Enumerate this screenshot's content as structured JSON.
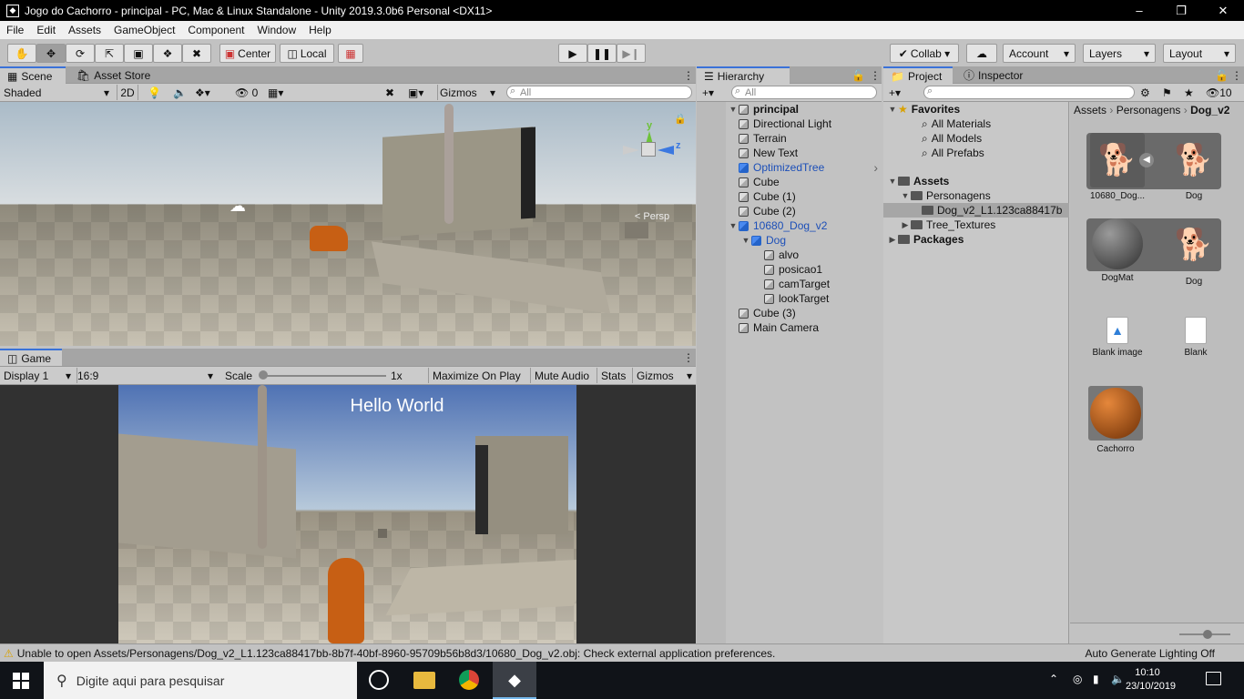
{
  "window": {
    "title": "Jogo do Cachorro - principal - PC, Mac & Linux Standalone - Unity 2019.3.0b6 Personal <DX11>",
    "min": "–",
    "max": "❐",
    "close": "✕"
  },
  "menu": [
    "File",
    "Edit",
    "Assets",
    "GameObject",
    "Component",
    "Window",
    "Help"
  ],
  "toolbar": {
    "center": "Center",
    "local": "Local",
    "collab": "Collab ▾",
    "account": "Account",
    "layers": "Layers",
    "layout": "Layout"
  },
  "scene": {
    "tabs": [
      "Scene",
      "Asset Store"
    ],
    "shading": "Shaded",
    "mode2d": "2D",
    "hidden_count": "0",
    "gizmos": "Gizmos",
    "search_placeholder": "All",
    "persp": "< Persp"
  },
  "game": {
    "tab": "Game",
    "display": "Display 1",
    "aspect": "16:9",
    "scale_label": "Scale",
    "scale_value": "1x",
    "maximize": "Maximize On Play",
    "mute": "Mute Audio",
    "stats": "Stats",
    "gizmos": "Gizmos",
    "hello_text": "Hello World"
  },
  "hierarchy": {
    "tab": "Hierarchy",
    "search_placeholder": "All",
    "items": [
      {
        "label": "principal",
        "depth": 0,
        "caret": "▼",
        "bold": true,
        "icon": "unity-scene-icon"
      },
      {
        "label": "Directional Light",
        "depth": 1
      },
      {
        "label": "Terrain",
        "depth": 1
      },
      {
        "label": "New Text",
        "depth": 1
      },
      {
        "label": "OptimizedTree",
        "depth": 1,
        "blue": true
      },
      {
        "label": "Cube",
        "depth": 1
      },
      {
        "label": "Cube (1)",
        "depth": 1
      },
      {
        "label": "Cube (2)",
        "depth": 1
      },
      {
        "label": "10680_Dog_v2",
        "depth": 1,
        "blue": true,
        "caret": "▼"
      },
      {
        "label": "Dog",
        "depth": 2,
        "blue": true,
        "caret": "▼"
      },
      {
        "label": "alvo",
        "depth": 3
      },
      {
        "label": "posicao1",
        "depth": 3
      },
      {
        "label": "camTarget",
        "depth": 3
      },
      {
        "label": "lookTarget",
        "depth": 3
      },
      {
        "label": "Cube (3)",
        "depth": 1
      },
      {
        "label": "Main Camera",
        "depth": 1
      }
    ]
  },
  "project": {
    "tabs": [
      "Project",
      "Inspector"
    ],
    "hidden_count": "10",
    "breadcrumb": [
      "Assets",
      "Personagens",
      "Dog_v2"
    ],
    "tree": [
      {
        "label": "Favorites",
        "kind": "header",
        "caret": "▼"
      },
      {
        "label": "All Materials",
        "kind": "search"
      },
      {
        "label": "All Models",
        "kind": "search"
      },
      {
        "label": "All Prefabs",
        "kind": "search"
      },
      {
        "label": "Assets",
        "kind": "header-folder",
        "caret": "▼"
      },
      {
        "label": "Personagens",
        "kind": "folder",
        "caret": "▼"
      },
      {
        "label": "Dog_v2_L1.123ca88417b",
        "kind": "folder-selected"
      },
      {
        "label": "Tree_Textures",
        "kind": "folder",
        "caret": "▶"
      },
      {
        "label": "Packages",
        "kind": "header-folder",
        "caret": "▶"
      }
    ],
    "assets": [
      {
        "label": "10680_Dog...",
        "type": "model"
      },
      {
        "label": "Dog",
        "type": "model-child"
      },
      {
        "label": "DogMat",
        "type": "material-grey"
      },
      {
        "label": "Dog",
        "type": "mesh"
      },
      {
        "label": "Blank image",
        "type": "image"
      },
      {
        "label": "Blank",
        "type": "file"
      },
      {
        "label": "Cachorro",
        "type": "material-orange"
      }
    ]
  },
  "status": {
    "warning": "Unable to open Assets/Personagens/Dog_v2_L1.123ca88417bb-8b7f-40bf-8960-95709b56b8d3/10680_Dog_v2.obj: Check external application preferences.",
    "lighting": "Auto Generate Lighting Off"
  },
  "taskbar": {
    "search_placeholder": "Digite aqui para pesquisar",
    "time": "10:10",
    "date": "23/10/2019"
  },
  "colors": {
    "accent": "#3a72d8",
    "blue_text": "#1c4fb8",
    "dog_orange": "#c75f14"
  }
}
